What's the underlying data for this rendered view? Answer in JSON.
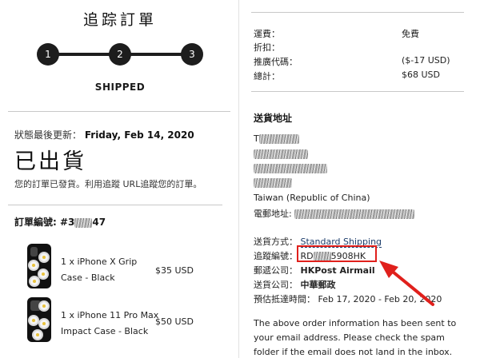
{
  "progress": {
    "title": "追踪訂單",
    "steps": [
      "1",
      "2",
      "3"
    ],
    "status_label": "SHIPPED"
  },
  "status": {
    "last_update_label": "狀態最後更新：",
    "last_update_date": "Friday, Feb 14, 2020",
    "heading": "已出貨",
    "description": "您的訂單已發貨。利用追蹤 URL追蹤您的訂單。"
  },
  "order": {
    "number_label": "訂單編號:",
    "number_prefix": "#3",
    "number_suffix": "47",
    "items": [
      {
        "name_line1": "1 x iPhone X Grip",
        "name_line2": "Case - Black",
        "price": "$35 USD"
      },
      {
        "name_line1": "1 x iPhone 11 Pro Max",
        "name_line2": "Impact Case - Black",
        "price": "$50 USD"
      }
    ]
  },
  "summary": {
    "rows": [
      {
        "label": "運費：",
        "value": "免費"
      },
      {
        "label": "折扣：",
        "value": ""
      },
      {
        "label": "推廣代碼：",
        "value": "($-17 USD)"
      },
      {
        "label": "總計：",
        "value": "$68 USD"
      }
    ]
  },
  "shipping": {
    "title": "送貨地址",
    "address_prefix": "T",
    "country": "Taiwan (Republic of China)",
    "phone_label": "電郵地址:",
    "method_label": "送貨方式：",
    "method_value": "Standard Shipping",
    "tracking_label": "追蹤編號：",
    "tracking_prefix": "RD",
    "tracking_suffix": "5908HK",
    "carrier_label": "郵遞公司：",
    "carrier_value": "HKPost Airmail",
    "courier_label": "送貨公司：",
    "courier_value": "中華郵政",
    "eta_label": "預估抵達時間：",
    "eta_value": "Feb 17, 2020 - Feb 20, 2020"
  },
  "notice": {
    "line1": "The above order information has been sent to",
    "line2": "your email address. Please check the spam",
    "line3": "folder if the email does not land in the inbox."
  },
  "colors": {
    "annotation": "#e0201c",
    "stepper": "#1d1d1d",
    "link": "#1c3d6b"
  }
}
